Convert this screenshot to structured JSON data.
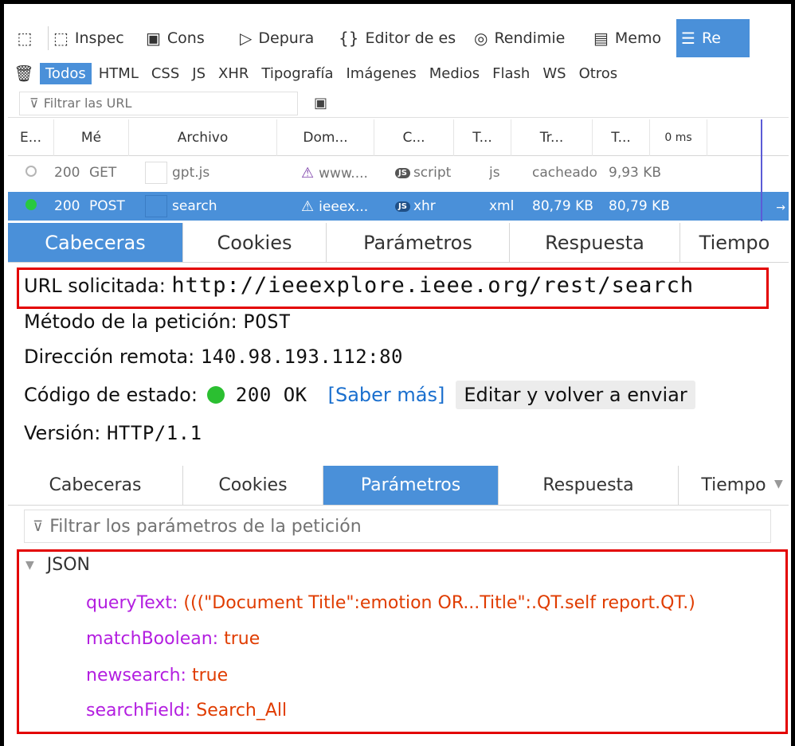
{
  "toolbar": {
    "items": [
      {
        "label": "Inspec",
        "icon": "inspector-icon"
      },
      {
        "label": "Cons",
        "icon": "console-icon"
      },
      {
        "label": "Depura",
        "icon": "debugger-icon"
      },
      {
        "label": "Editor de es",
        "icon": "style-editor-icon"
      },
      {
        "label": "Rendimie",
        "icon": "performance-icon"
      },
      {
        "label": "Memo",
        "icon": "memory-icon"
      },
      {
        "label": "Re",
        "icon": "network-icon"
      }
    ]
  },
  "types": [
    "Todos",
    "HTML",
    "CSS",
    "JS",
    "XHR",
    "Tipografía",
    "Imágenes",
    "Medios",
    "Flash",
    "WS",
    "Otros"
  ],
  "url_filter": {
    "placeholder": "Filtrar las URL"
  },
  "columns": [
    "E...",
    "Mé",
    "Archivo",
    "Dom...",
    "C...",
    "T...",
    "Tr...",
    "T...",
    "0 ms"
  ],
  "requests": [
    {
      "status": "200",
      "method": "GET",
      "file": "gpt.js",
      "domain": "www....",
      "cause": "script",
      "type": "js",
      "transferred": "cacheado",
      "size": "9,93 KB"
    },
    {
      "status": "200",
      "method": "POST",
      "file": "search",
      "domain": "ieeex...",
      "cause": "xhr",
      "type": "xml",
      "transferred": "80,79 KB",
      "size": "80,79 KB"
    }
  ],
  "tabs": [
    "Cabeceras",
    "Cookies",
    "Parámetros",
    "Respuesta",
    "Tiempo"
  ],
  "headers": {
    "url_label": "URL solicitada:",
    "url_value": "http://ieeexplore.ieee.org/rest/search",
    "method_label": "Método de la petición:",
    "method_value": "POST",
    "remote_label": "Dirección remota:",
    "remote_value": "140.98.193.112:80",
    "status_label": "Código de estado:",
    "status_value": "200 OK",
    "learn_more": "[Saber más]",
    "resend": "Editar y volver a enviar",
    "version_label": "Versión:",
    "version_value": "HTTP/1.1"
  },
  "params": {
    "filter_placeholder": "Filtrar los parámetros de la petición",
    "section": "JSON",
    "entries": [
      {
        "key": "queryText:",
        "value": "(((\"Document Title\":emotion OR...Title\":.QT.self report.QT.)"
      },
      {
        "key": "matchBoolean:",
        "value": "true"
      },
      {
        "key": "newsearch:",
        "value": "true"
      },
      {
        "key": "searchField:",
        "value": "Search_All"
      }
    ]
  },
  "colors": {
    "accent": "#4a90d9",
    "highlight_box": "#e30000",
    "json_key": "#b31ee0",
    "json_value": "#e03c00",
    "status_ok": "#2bbf31"
  }
}
